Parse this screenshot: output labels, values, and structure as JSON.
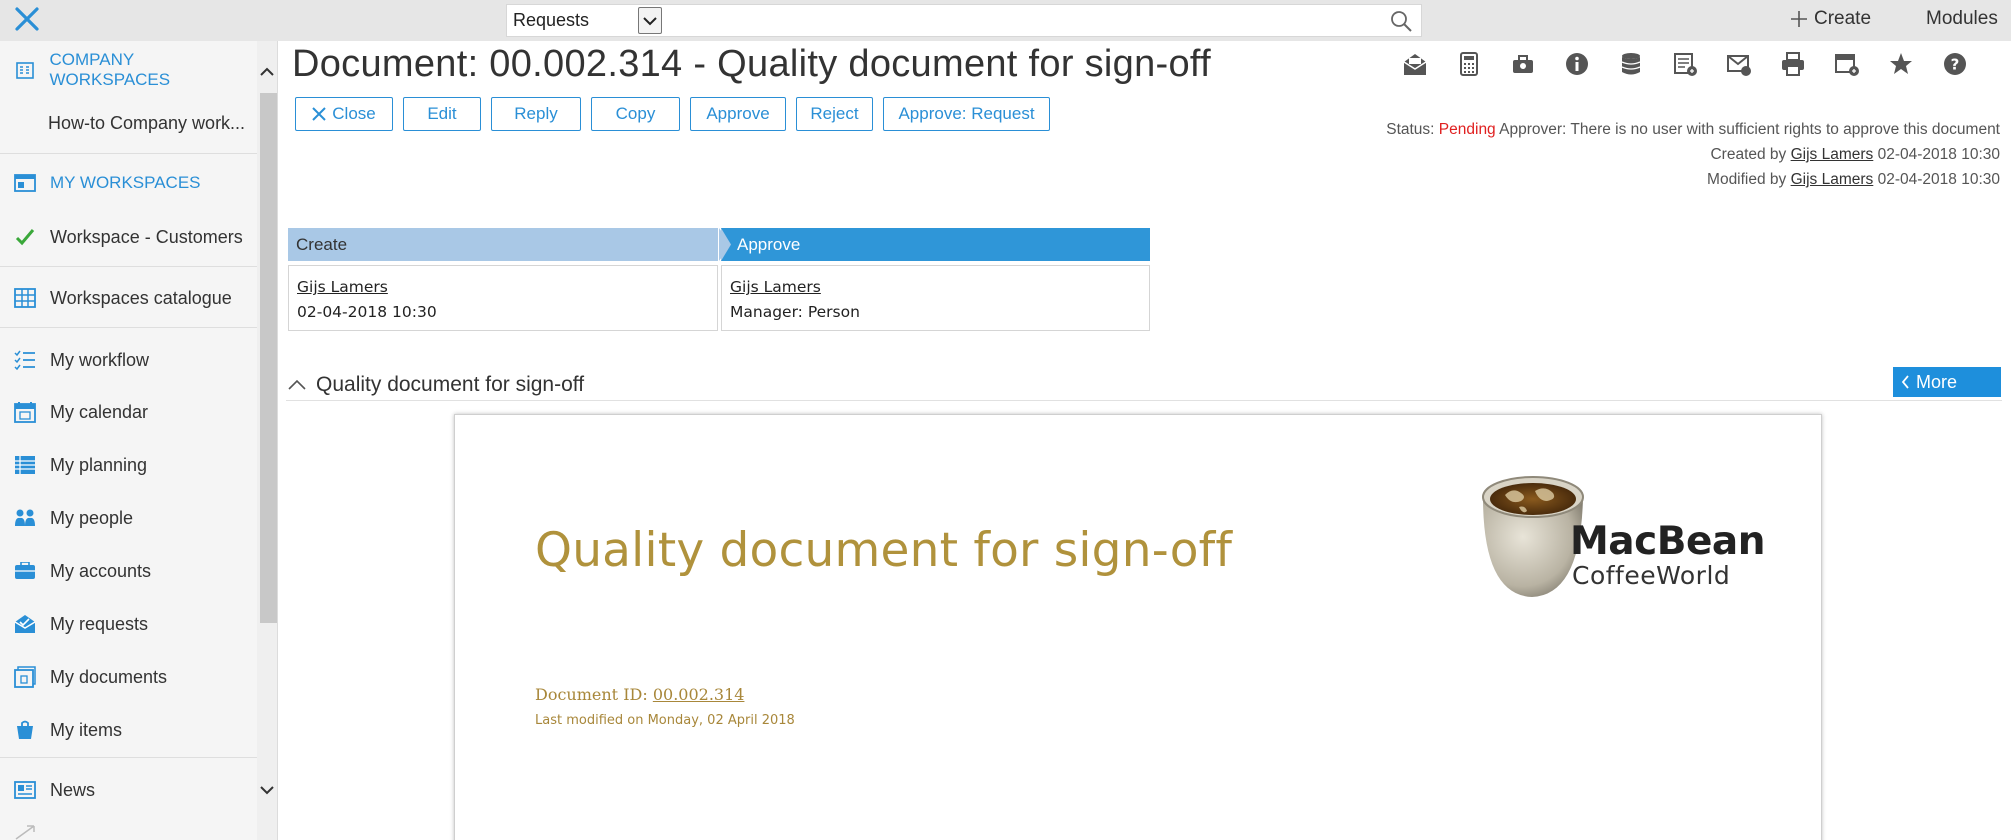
{
  "topbar": {
    "search_category": "Requests",
    "search_placeholder": "",
    "create_label": "Create",
    "modules_label": "Modules"
  },
  "sidebar": {
    "company_workspaces": "COMPANY WORKSPACES",
    "howto": "How-to Company work...",
    "my_workspaces": "MY WORKSPACES",
    "workspace_customers": "Workspace - Customers",
    "catalogue": "Workspaces catalogue",
    "items": [
      {
        "label": "My workflow",
        "icon": "workflow-icon"
      },
      {
        "label": "My calendar",
        "icon": "calendar-icon"
      },
      {
        "label": "My planning",
        "icon": "planning-icon"
      },
      {
        "label": "My people",
        "icon": "people-icon"
      },
      {
        "label": "My accounts",
        "icon": "accounts-icon"
      },
      {
        "label": "My requests",
        "icon": "requests-icon"
      },
      {
        "label": "My documents",
        "icon": "documents-icon"
      },
      {
        "label": "My items",
        "icon": "items-icon"
      }
    ],
    "news": "News"
  },
  "document": {
    "title": "Document: 00.002.314 - Quality document for sign-off",
    "actions": {
      "close": "Close",
      "edit": "Edit",
      "reply": "Reply",
      "copy": "Copy",
      "approve": "Approve",
      "reject": "Reject",
      "approve_request": "Approve: Request"
    },
    "status": {
      "status_label": "Status:",
      "status_value": "Pending",
      "approver_text": "Approver: There is no user with sufficient rights to approve this document",
      "created_prefix": "Created by",
      "created_user": "Gijs Lamers",
      "created_date": "02-04-2018 10:30",
      "modified_prefix": "Modified by",
      "modified_user": "Gijs Lamers",
      "modified_date": "02-04-2018 10:30"
    },
    "workflow": {
      "create_header": "Create",
      "approve_header": "Approve",
      "create_user": "Gijs Lamers",
      "create_date": "02-04-2018 10:30",
      "approve_user": "Gijs Lamers",
      "approve_role": "Manager: Person"
    },
    "section_title": "Quality document for sign-off",
    "more_label": "More",
    "preview": {
      "title": "Quality document for sign-off",
      "docid_label": "Document ID:",
      "docid_value": "00.002.314",
      "last_modified": "Last modified on Monday, 02 April 2018",
      "logo_name": "MacBean",
      "logo_sub": "CoffeeWorld"
    }
  },
  "colors": {
    "accent": "#2a8fd6",
    "pending": "#e02020",
    "workflow_done": "#a9c8e6",
    "workflow_active": "#2f96d8",
    "preview_gold": "#b0923c"
  }
}
